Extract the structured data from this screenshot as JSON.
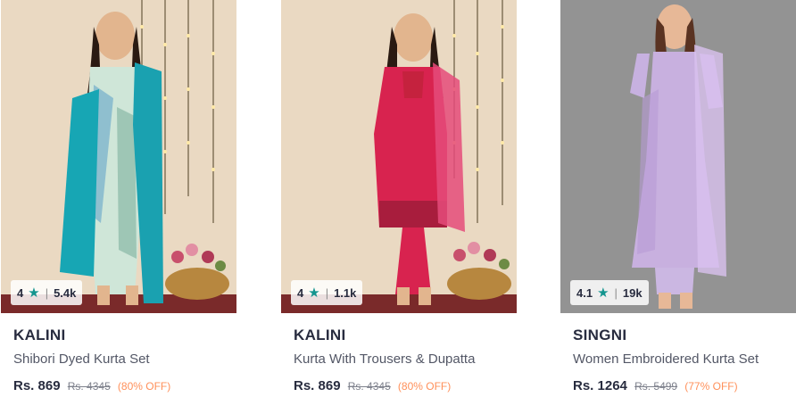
{
  "products": [
    {
      "brand": "KALINI",
      "name": "Shibori Dyed Kurta Set",
      "price": "Rs. 869",
      "mrp": "Rs. 4345",
      "discount": "(80% OFF)",
      "rating": "4",
      "rating_count": "5.4k",
      "image_alt": "woman-in-tie-dye-kurta-with-teal-dupatta"
    },
    {
      "brand": "KALINI",
      "name": "Kurta With Trousers & Dupatta",
      "price": "Rs. 869",
      "mrp": "Rs. 4345",
      "discount": "(80% OFF)",
      "rating": "4",
      "rating_count": "1.1k",
      "image_alt": "woman-in-pink-kurta-with-dupatta"
    },
    {
      "brand": "SINGNI",
      "name": "Women Embroidered Kurta Set",
      "price": "Rs. 1264",
      "mrp": "Rs. 5499",
      "discount": "(77% OFF)",
      "rating": "4.1",
      "rating_count": "19k",
      "image_alt": "woman-in-lavender-embroidered-kurta"
    }
  ],
  "icons": {
    "rating_star": "star-icon",
    "separator": "|"
  },
  "colors": {
    "star": "#14958f",
    "discount": "#ff905a",
    "brand_text": "#282c3f",
    "name_text": "#535766"
  }
}
